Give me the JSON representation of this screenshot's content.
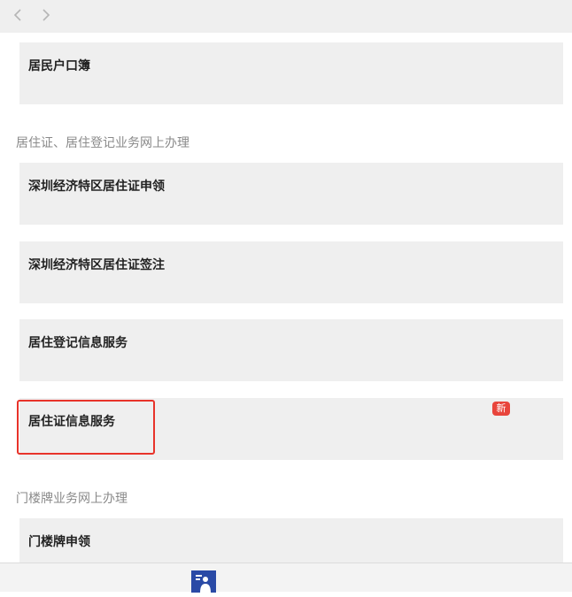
{
  "nav": {
    "back_icon": "chevron-left-icon",
    "forward_icon": "chevron-right-icon"
  },
  "cards": {
    "household_register": "居民户口簿",
    "residence_permit_apply": "深圳经济特区居住证申领",
    "residence_permit_endorse": "深圳经济特区居住证签注",
    "residence_registration_info": "居住登记信息服务",
    "residence_permit_info": "居住证信息服务",
    "doorplate_apply": "门楼牌申领"
  },
  "sections": {
    "residence": "居住证、居住登记业务网上办理",
    "doorplate": "门楼牌业务网上办理"
  },
  "badge": {
    "new": "新",
    "color": "#e8453c"
  },
  "colors": {
    "card_bg": "#efefef",
    "highlight_border": "#e8332a",
    "app_icon": "#2a4aa6"
  },
  "bottom": {
    "app_icon": "person-card-icon"
  }
}
